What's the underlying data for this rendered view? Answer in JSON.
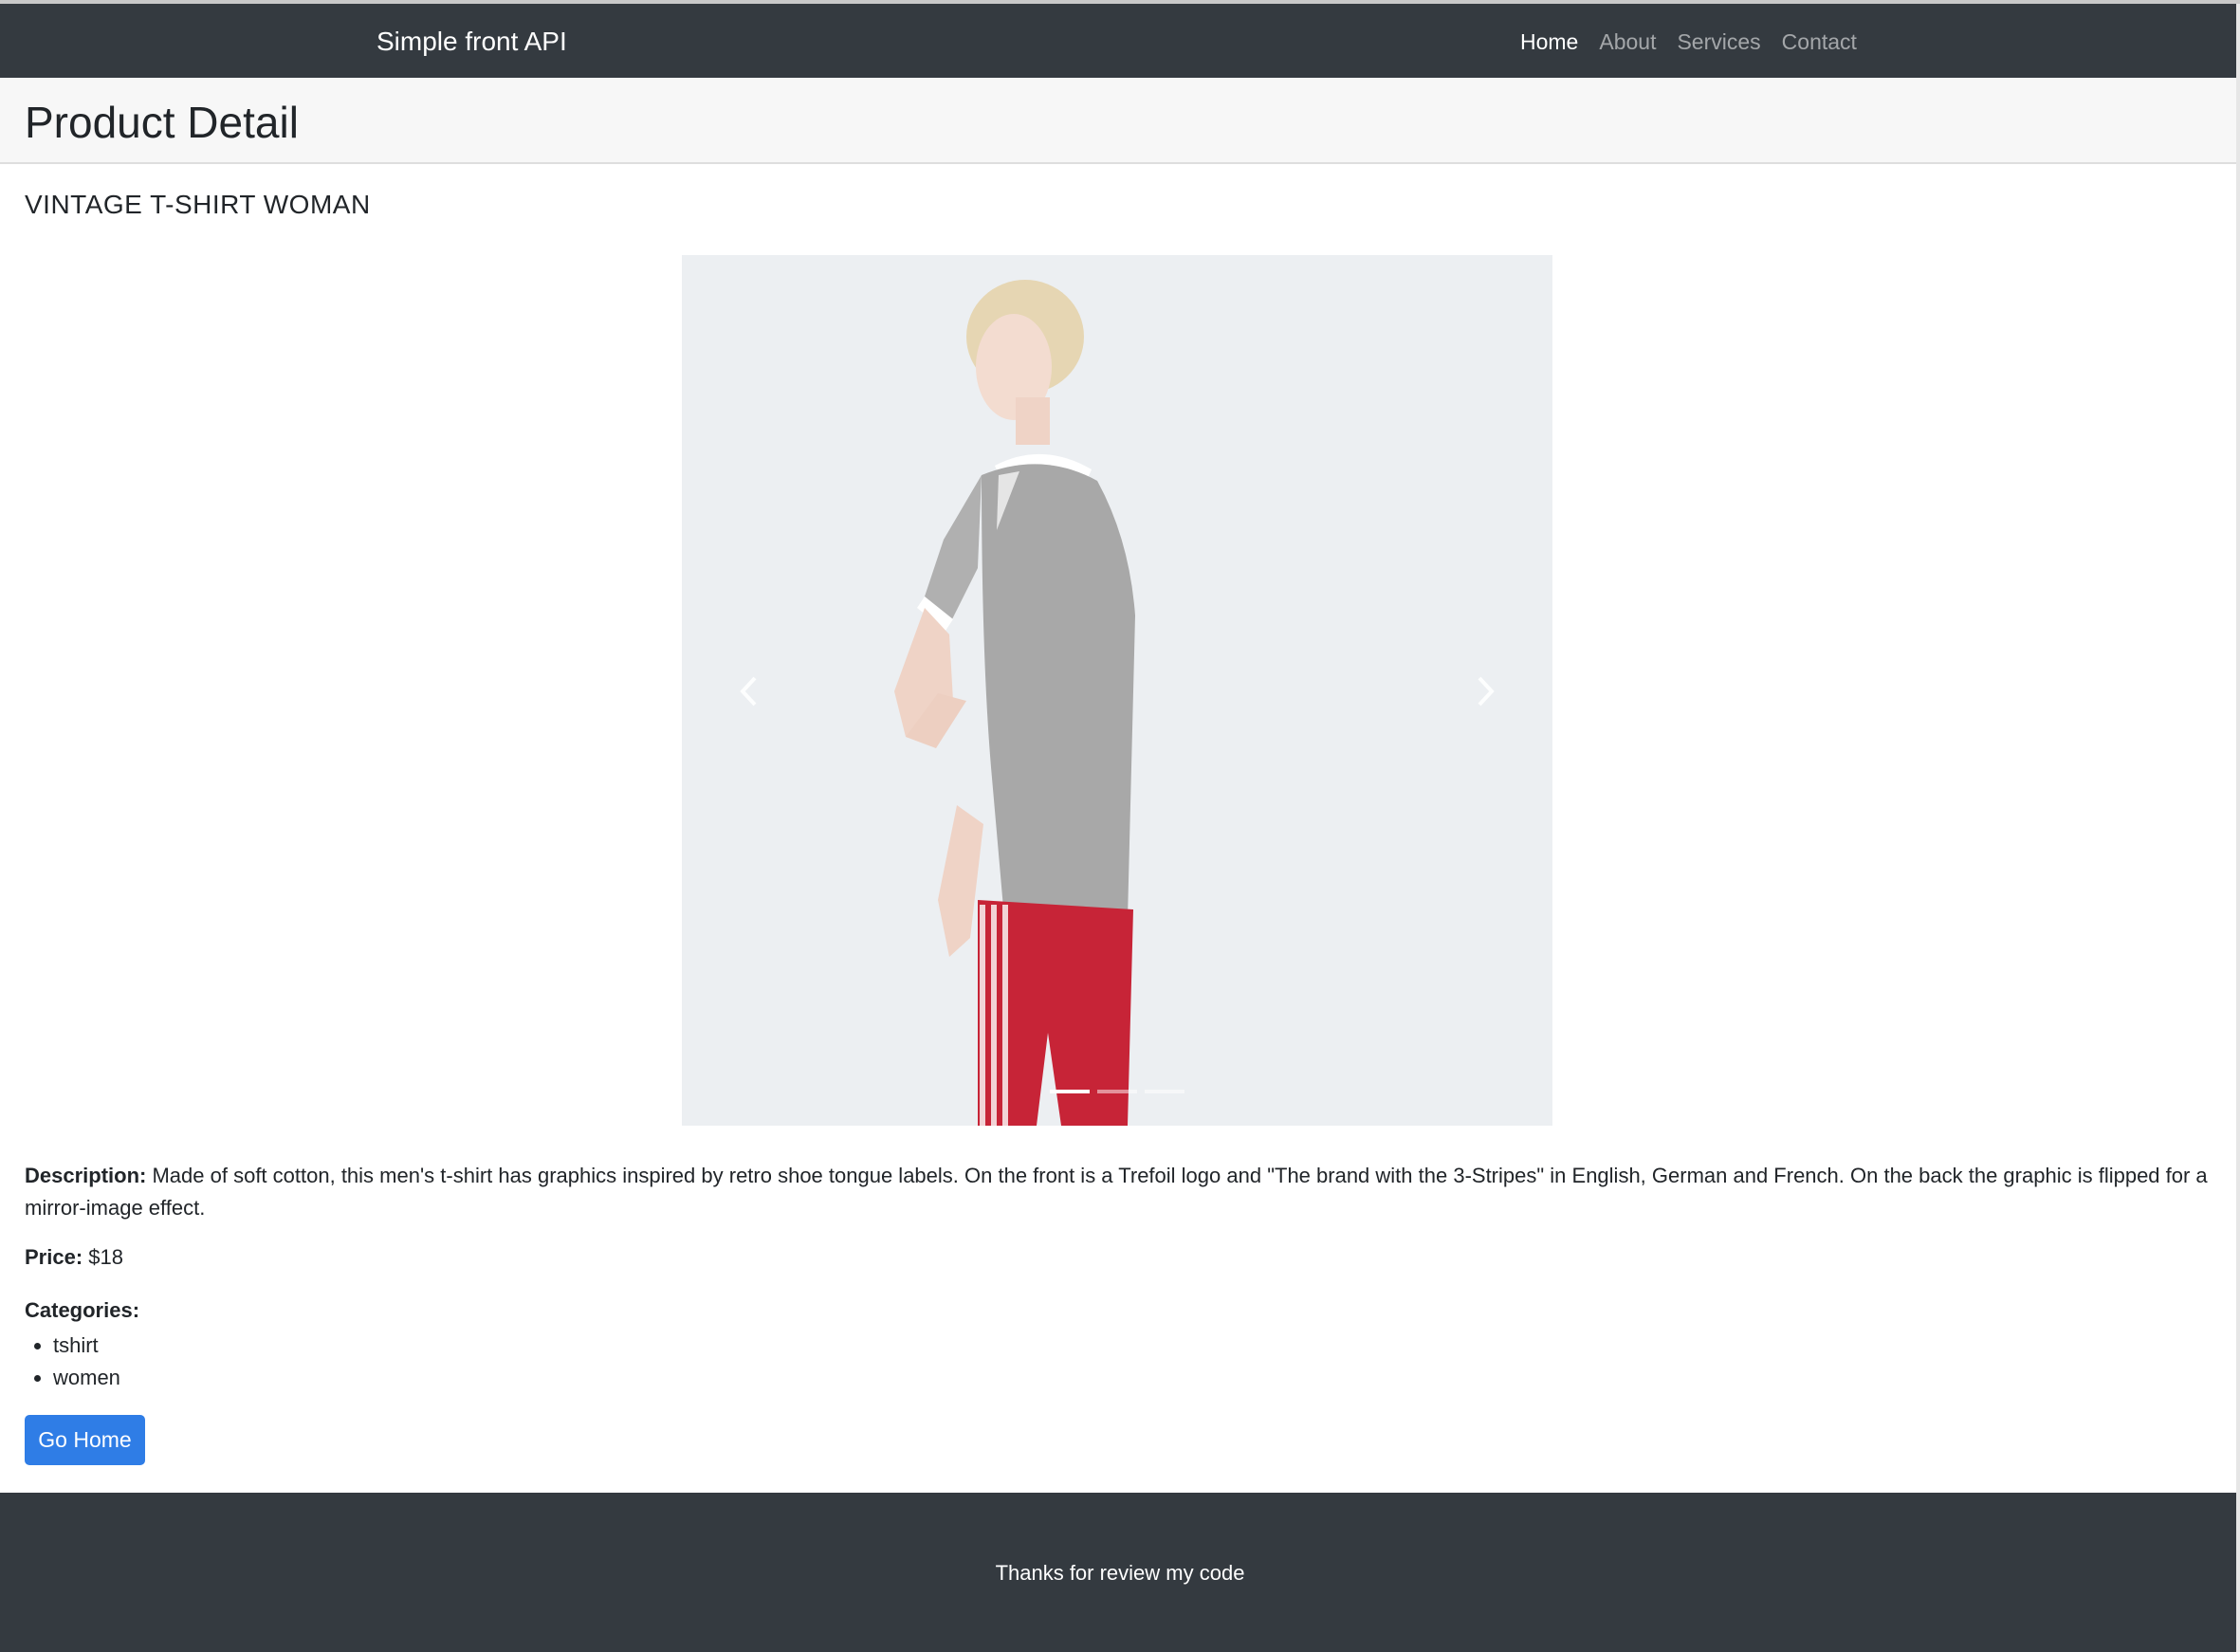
{
  "navbar": {
    "brand": "Simple front API",
    "links": [
      {
        "label": "Home",
        "active": true
      },
      {
        "label": "About",
        "active": false
      },
      {
        "label": "Services",
        "active": false
      },
      {
        "label": "Contact",
        "active": false
      }
    ]
  },
  "header": {
    "title": "Product Detail"
  },
  "product": {
    "name": "VINTAGE T-SHIRT WOMAN",
    "description_label": "Description:",
    "description": "Made of soft cotton, this men's t-shirt has graphics inspired by retro shoe tongue labels. On the front is a Trefoil logo and \"The brand with the 3-Stripes\" in English, German and French. On the back the graphic is flipped for a mirror-image effect.",
    "price_label": "Price:",
    "price": "$18",
    "categories_label": "Categories:",
    "categories": [
      "tshirt",
      "women"
    ]
  },
  "carousel": {
    "slide_count": 3,
    "active_slide": 1,
    "prev_icon": "chevron-left-icon",
    "next_icon": "chevron-right-icon"
  },
  "actions": {
    "go_home_label": "Go Home"
  },
  "footer": {
    "text": "Thanks for review my code"
  },
  "colors": {
    "navbar_bg": "#343a40",
    "header_bg": "#f7f7f7",
    "button_bg": "#2f7de6",
    "carousel_bg": "#eceff2"
  }
}
